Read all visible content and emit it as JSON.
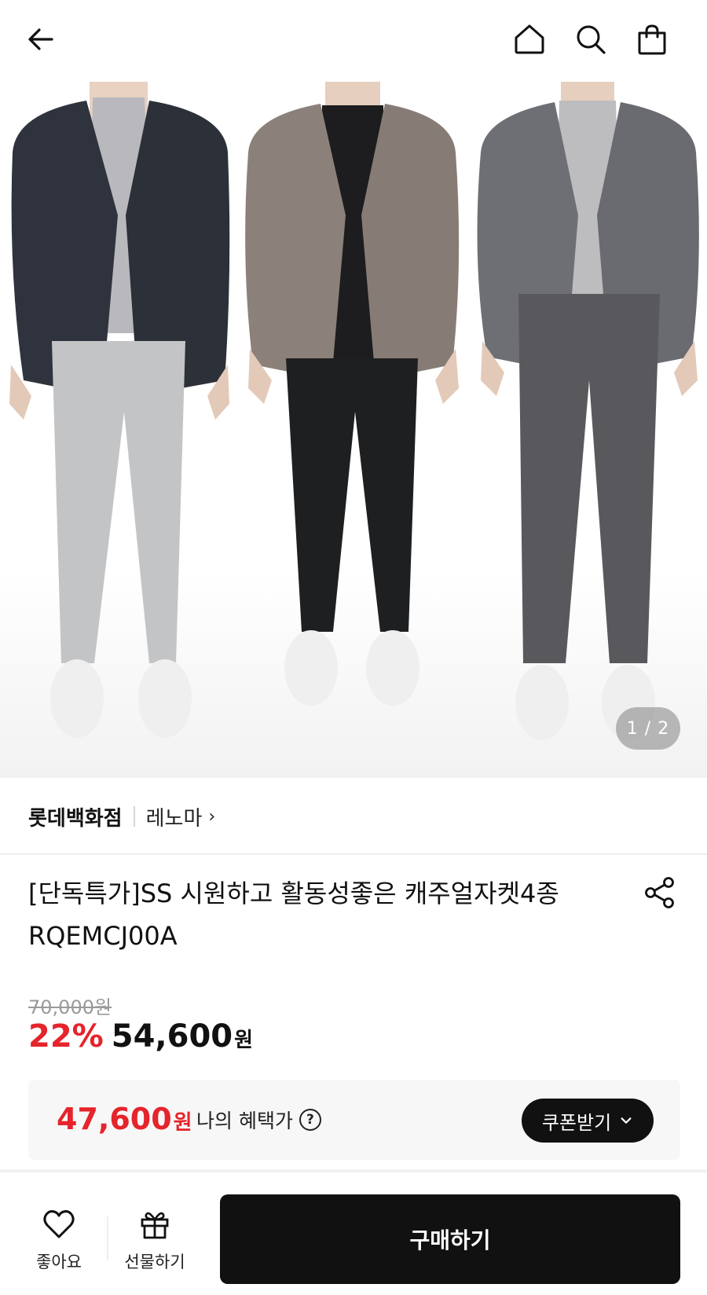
{
  "header": {
    "back_icon": "arrow-left-icon",
    "home_icon": "home-icon",
    "search_icon": "search-icon",
    "cart_icon": "shopping-bag-icon"
  },
  "gallery": {
    "counter": "1 / 2",
    "current": 1,
    "total": 2
  },
  "store": {
    "name": "롯데백화점",
    "brand": "레노마",
    "brand_chevron": "›"
  },
  "product": {
    "title_line1": "[단독특가]SS 시원하고 활동성좋은 캐주얼자켓4종",
    "title_line2": "RQEMCJ00A",
    "share_icon": "share-icon"
  },
  "pricing": {
    "original_price": "70,000원",
    "discount_rate": "22%",
    "sale_price": "54,600",
    "currency": "원"
  },
  "benefit": {
    "price": "47,600",
    "currency": "원",
    "label": "나의 혜택가",
    "help": "?",
    "coupon_button": "쿠폰받기",
    "coupon_chevron": "⌄"
  },
  "bottom_bar": {
    "like_label": "좋아요",
    "gift_label": "선물하기",
    "buy_label": "구매하기"
  },
  "colors": {
    "accent_red": "#e5242b",
    "black": "#111111"
  }
}
